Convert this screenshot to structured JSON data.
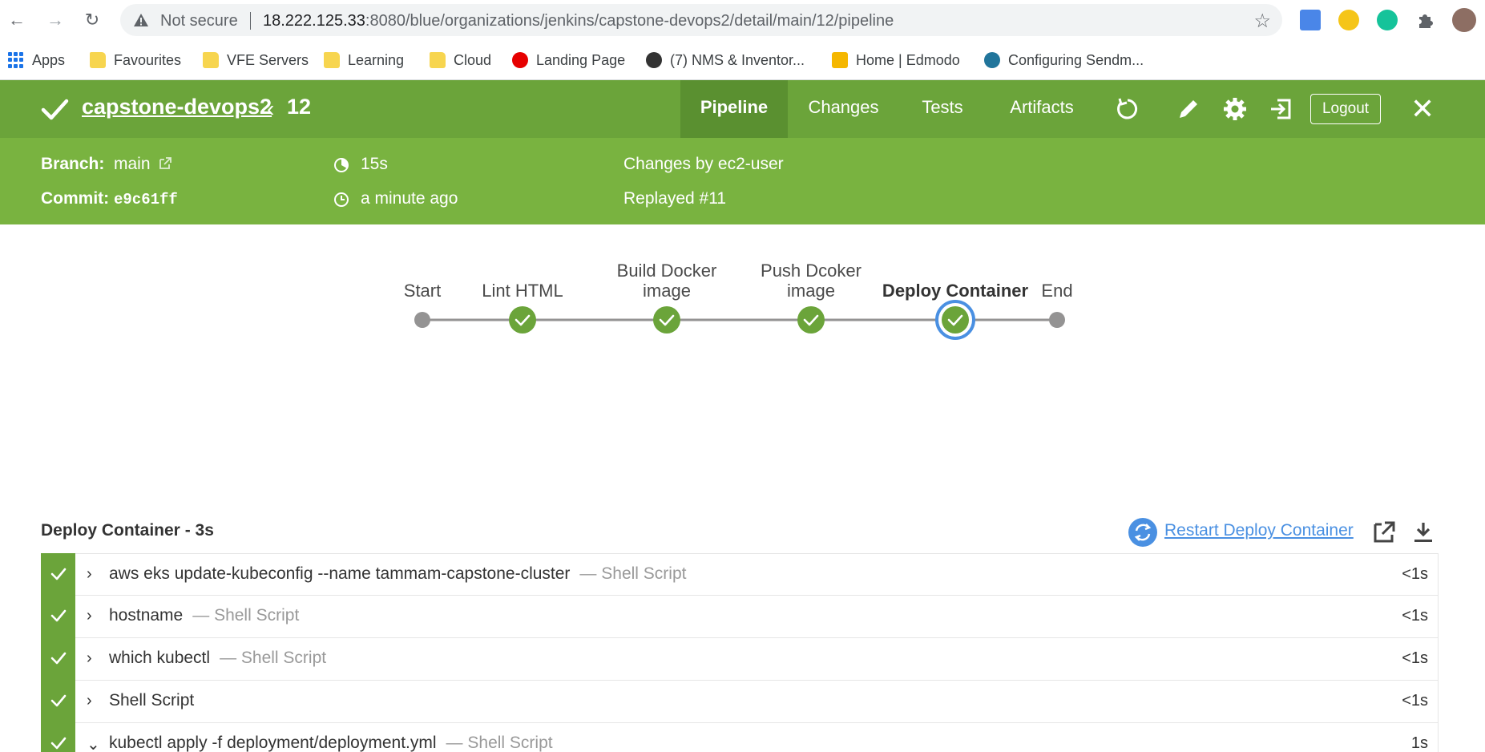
{
  "browser": {
    "not_secure": "Not secure",
    "url_host": "18.222.125.33",
    "url_rest": ":8080/blue/organizations/jenkins/capstone-devops2/detail/main/12/pipeline"
  },
  "bookmarks": [
    {
      "label": "Apps"
    },
    {
      "label": "Favourites"
    },
    {
      "label": "VFE Servers"
    },
    {
      "label": "Learning"
    },
    {
      "label": "Cloud"
    },
    {
      "label": "Landing Page"
    },
    {
      "label": "(7) NMS & Inventor..."
    },
    {
      "label": "Home | Edmodo"
    },
    {
      "label": "Configuring Sendm..."
    }
  ],
  "header": {
    "run_name": "capstone-devops2",
    "run_number": "12",
    "tabs": [
      "Pipeline",
      "Changes",
      "Tests",
      "Artifacts"
    ],
    "active_tab": "Pipeline",
    "logout": "Logout",
    "accent": "#6ba43a"
  },
  "summary": {
    "branch_label": "Branch:",
    "branch": "main",
    "commit_label": "Commit:",
    "commit": "e9c61ff",
    "duration": "15s",
    "time_ago": "a minute ago",
    "changes_by": "Changes by ec2-user",
    "replayed": "Replayed #11"
  },
  "pipeline": {
    "stages": [
      {
        "name": "Start",
        "status": "node"
      },
      {
        "name": "Lint HTML",
        "status": "success"
      },
      {
        "name": "Build Docker image",
        "status": "success"
      },
      {
        "name": "Push Dcoker image",
        "status": "success"
      },
      {
        "name": "Deploy Container",
        "status": "success",
        "selected": true
      },
      {
        "name": "End",
        "status": "node"
      }
    ]
  },
  "steps_panel": {
    "title": "Deploy Container - 3s",
    "restart_label": "Restart Deploy Container",
    "steps": [
      {
        "command": "aws eks update-kubeconfig --name tammam-capstone-cluster",
        "type": "— Shell Script",
        "duration": "<1s",
        "expanded": false
      },
      {
        "command": "hostname",
        "type": "— Shell Script",
        "duration": "<1s",
        "expanded": false
      },
      {
        "command": "which kubectl",
        "type": "— Shell Script",
        "duration": "<1s",
        "expanded": false
      },
      {
        "command": "Shell Script",
        "type": "",
        "duration": "<1s",
        "expanded": false
      },
      {
        "command": "kubectl apply -f deployment/deployment.yml",
        "type": "— Shell Script",
        "duration": "1s",
        "expanded": true
      }
    ]
  }
}
